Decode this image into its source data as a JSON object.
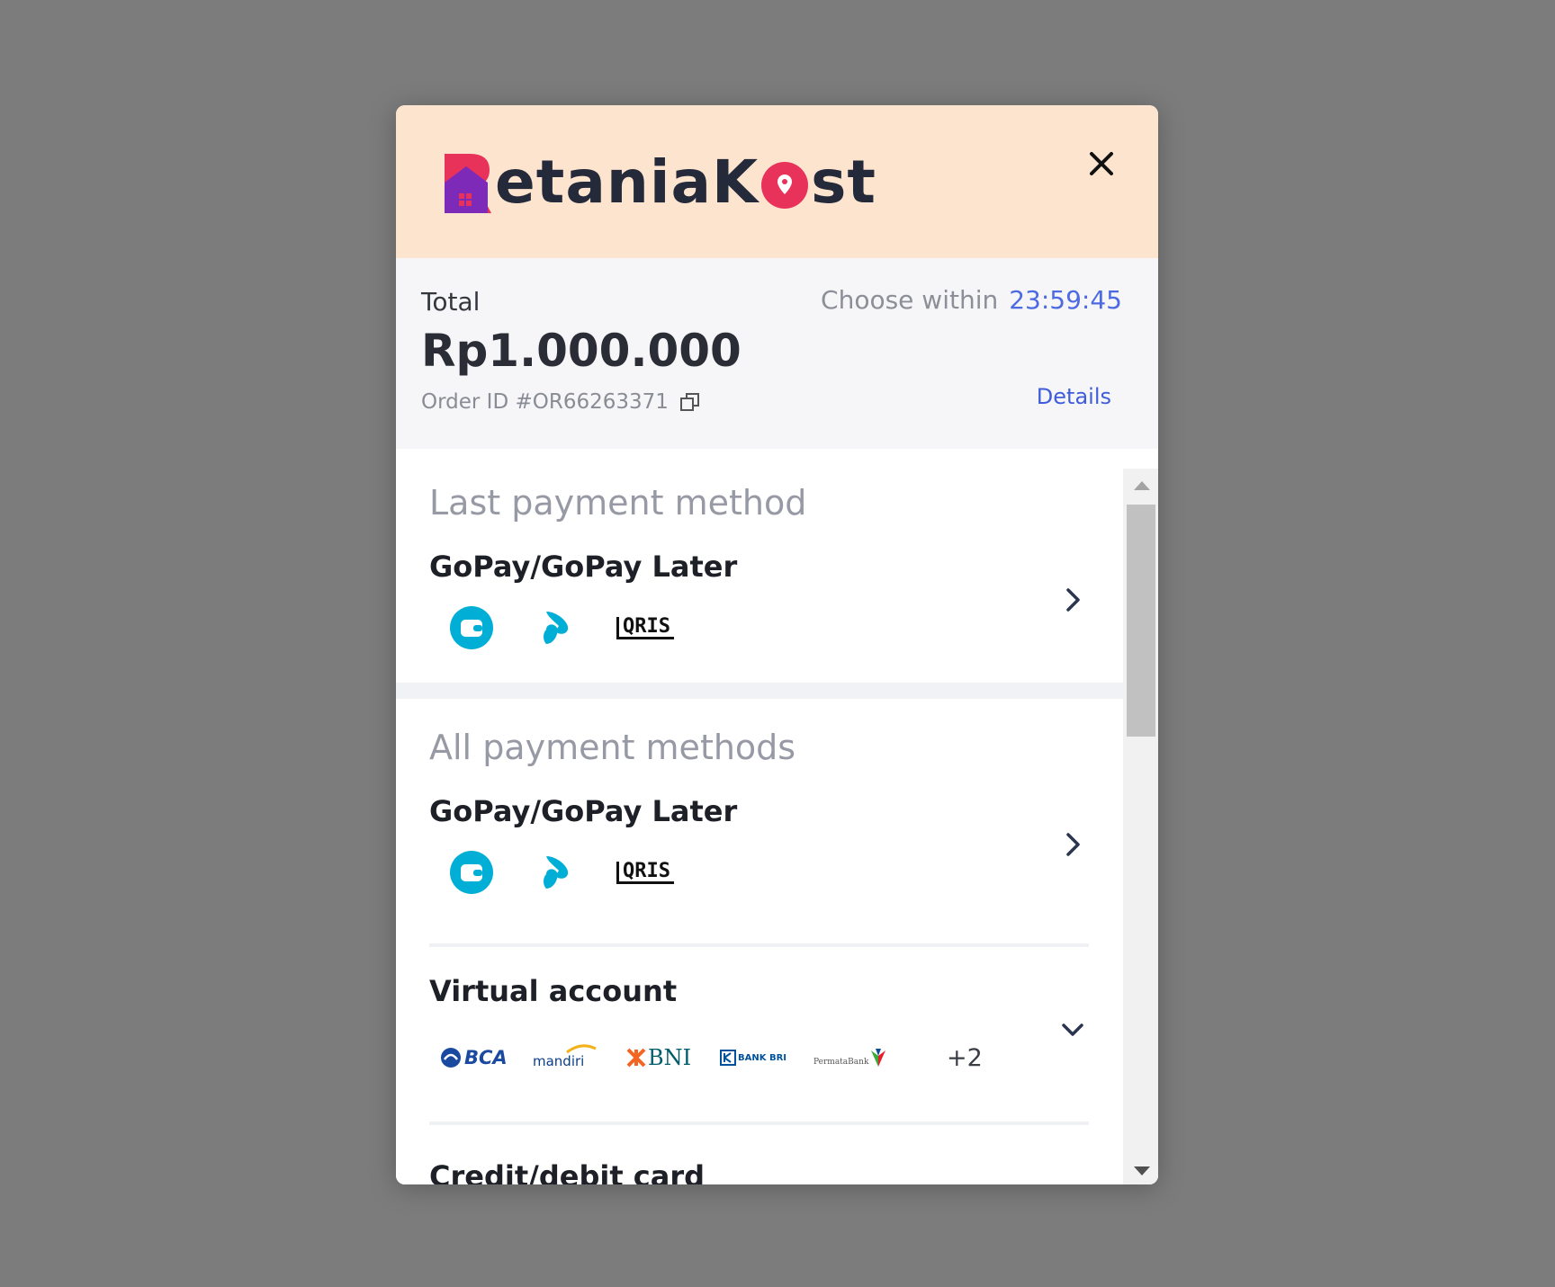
{
  "brand": {
    "name_part1": "etaniaK",
    "name_part2": "st",
    "accent_color": "#e8325a",
    "mark_color": "#7d2ab8"
  },
  "summary": {
    "total_label": "Total",
    "total_amount": "Rp1.000.000",
    "order_id": "Order ID #OR66263371",
    "choose_within_label": "Choose within",
    "timer": "23:59:45",
    "details_label": "Details"
  },
  "last_payment": {
    "section_title": "Last payment method",
    "method_name": "GoPay/GoPay Later",
    "icons": [
      "gopay-wallet-icon",
      "gopay-later-icon",
      "qris-logo"
    ]
  },
  "all_payments": {
    "section_title": "All payment methods",
    "methods": [
      {
        "name": "GoPay/GoPay Later",
        "icons": [
          "gopay-wallet-icon",
          "gopay-later-icon",
          "qris-logo"
        ]
      },
      {
        "name": "Virtual account",
        "banks": [
          "BCA",
          "mandiri",
          "BNI",
          "BANK BRI",
          "PermataBank"
        ],
        "more_count": "+2"
      }
    ],
    "next_partial": "Credit/debit card"
  },
  "qris_text": "QRIS",
  "colors": {
    "header_bg": "#fde4cf",
    "summary_bg": "#f6f6f9",
    "timer": "#4e6ae3",
    "gopay_blue": "#00aed6"
  }
}
